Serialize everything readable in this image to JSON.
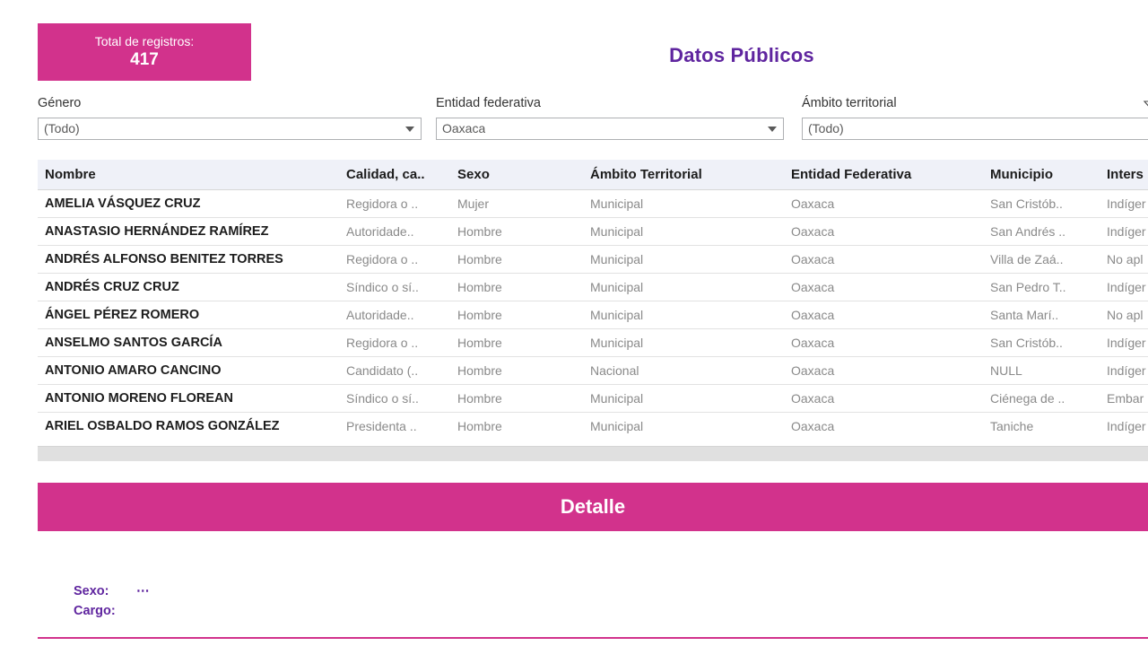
{
  "kpi": {
    "label": "Total de registros:",
    "value": "417"
  },
  "header": {
    "title": "Datos Públicos"
  },
  "filters": {
    "genero": {
      "label": "Género",
      "value": "(Todo)"
    },
    "entidad": {
      "label": "Entidad federativa",
      "value": "Oaxaca"
    },
    "ambito": {
      "label": "Ámbito territorial",
      "value": "(Todo)"
    },
    "clear_filter_icon": "clear-filter-icon",
    "dropdown_icon": "chevron-down-icon"
  },
  "table": {
    "columns": [
      "Nombre",
      "Calidad, ca..",
      "Sexo",
      "Ámbito Territorial",
      "Entidad Federativa",
      "Municipio",
      "Inters"
    ],
    "rows": [
      {
        "nombre": "AMELIA VÁSQUEZ CRUZ",
        "calidad": "Regidora o ..",
        "sexo": "Mujer",
        "ambito": "Municipal",
        "entidad": "Oaxaca",
        "municipio": "San Cristób..",
        "interseccionalidad": "Indíger"
      },
      {
        "nombre": "ANASTASIO HERNÁNDEZ RAMÍREZ",
        "calidad": "Autoridade..",
        "sexo": "Hombre",
        "ambito": "Municipal",
        "entidad": "Oaxaca",
        "municipio": "San Andrés ..",
        "interseccionalidad": "Indíger"
      },
      {
        "nombre": "ANDRÉS ALFONSO BENITEZ TORRES",
        "calidad": "Regidora o ..",
        "sexo": "Hombre",
        "ambito": "Municipal",
        "entidad": "Oaxaca",
        "municipio": "Villa de Zaá..",
        "interseccionalidad": "No apl"
      },
      {
        "nombre": "ANDRÉS CRUZ CRUZ",
        "calidad": "Síndico o sí..",
        "sexo": "Hombre",
        "ambito": "Municipal",
        "entidad": "Oaxaca",
        "municipio": "San Pedro T..",
        "interseccionalidad": "Indíger"
      },
      {
        "nombre": "ÁNGEL PÉREZ ROMERO",
        "calidad": "Autoridade..",
        "sexo": "Hombre",
        "ambito": "Municipal",
        "entidad": "Oaxaca",
        "municipio": "Santa Marí..",
        "interseccionalidad": "No apl"
      },
      {
        "nombre": "ANSELMO SANTOS GARCÍA",
        "calidad": "Regidora o ..",
        "sexo": "Hombre",
        "ambito": "Municipal",
        "entidad": "Oaxaca",
        "municipio": "San Cristób..",
        "interseccionalidad": "Indíger"
      },
      {
        "nombre": "ANTONIO AMARO CANCINO",
        "calidad": "Candidato (..",
        "sexo": "Hombre",
        "ambito": "Nacional",
        "entidad": "Oaxaca",
        "municipio": "NULL",
        "interseccionalidad": "Indíger"
      },
      {
        "nombre": "ANTONIO MORENO FLOREAN",
        "calidad": "Síndico o sí..",
        "sexo": "Hombre",
        "ambito": "Municipal",
        "entidad": "Oaxaca",
        "municipio": "Ciénega de ..",
        "interseccionalidad": "Embar"
      },
      {
        "nombre": "ARIEL OSBALDO RAMOS GONZÁLEZ",
        "calidad": "Presidenta ..",
        "sexo": "Hombre",
        "ambito": "Municipal",
        "entidad": "Oaxaca",
        "municipio": "Taniche",
        "interseccionalidad": "Indíger"
      }
    ]
  },
  "detalle": {
    "banner_title": "Detalle",
    "fields": [
      {
        "key": "Sexo:",
        "value": "⋯"
      },
      {
        "key": "Cargo:",
        "value": ""
      }
    ]
  },
  "colors": {
    "pink": "#d2328c",
    "purple": "#5f259f",
    "header_bg": "#eff1f8"
  }
}
